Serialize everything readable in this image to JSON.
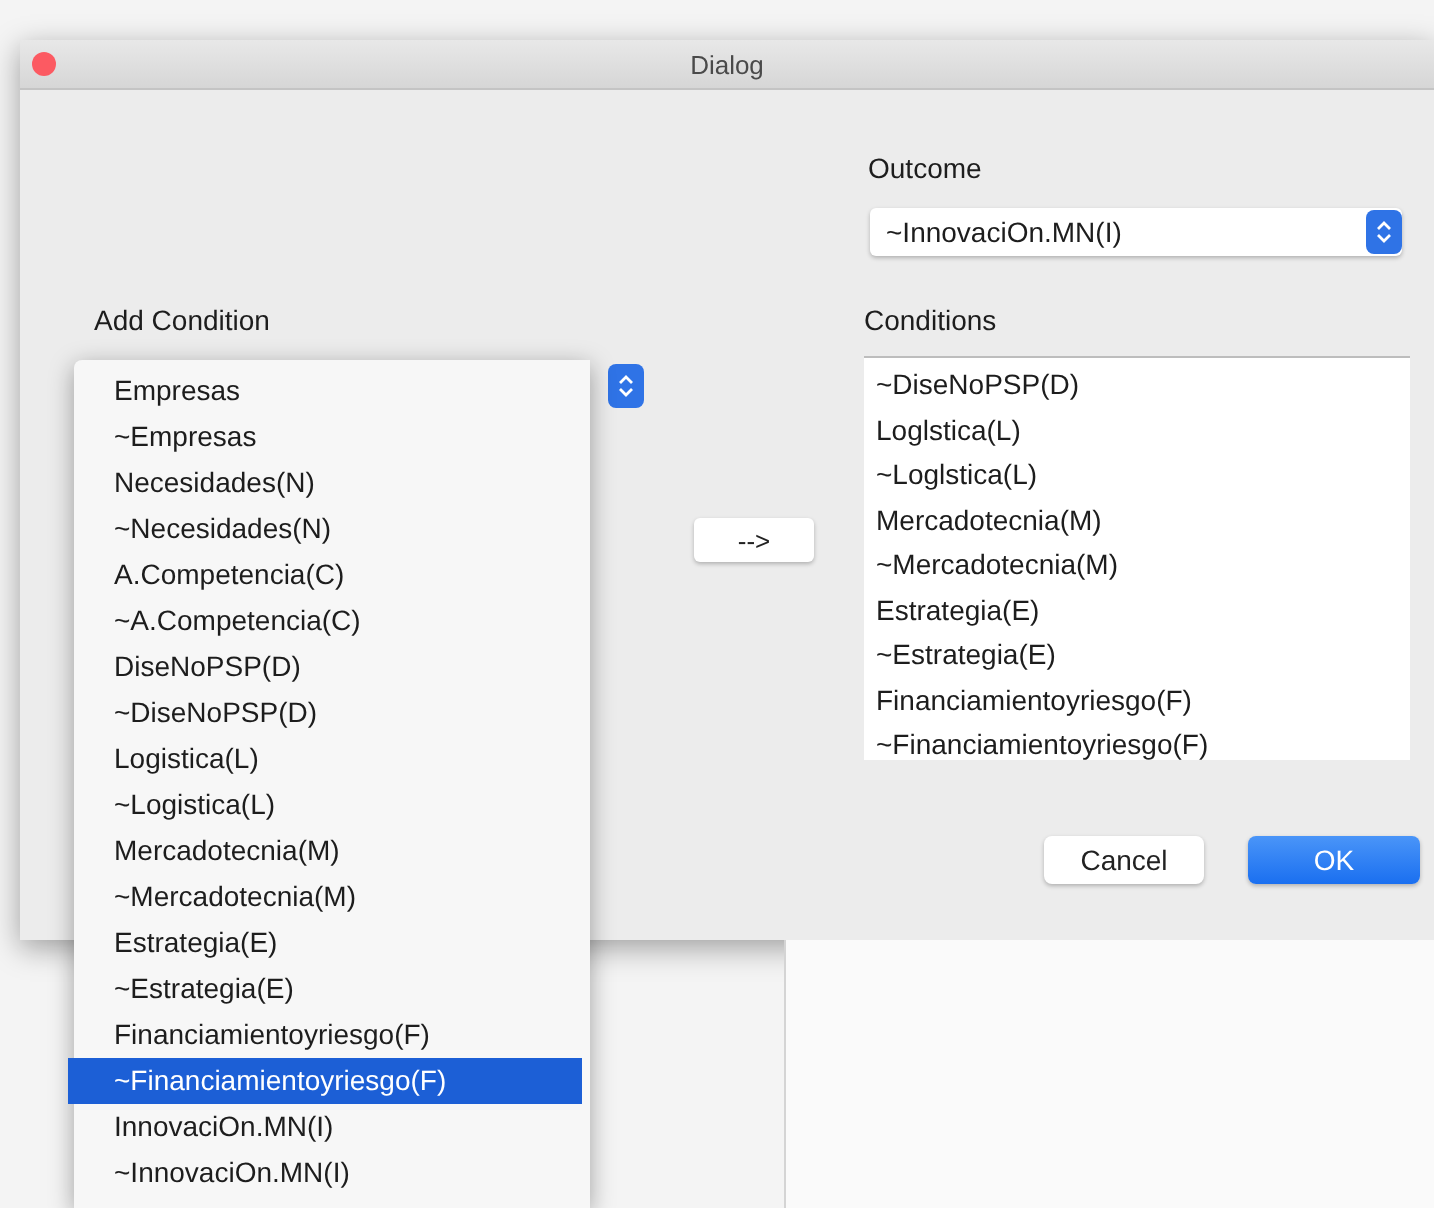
{
  "window": {
    "title": "Dialog"
  },
  "outcome": {
    "label": "Outcome",
    "value": "~InnovaciOn.MN(I)"
  },
  "add_condition": {
    "label": "Add Condition",
    "options": [
      {
        "label": "Empresas",
        "selected": false
      },
      {
        "label": "~Empresas",
        "selected": false
      },
      {
        "label": "Necesidades(N)",
        "selected": false
      },
      {
        "label": "~Necesidades(N)",
        "selected": false
      },
      {
        "label": "A.Competencia(C)",
        "selected": false
      },
      {
        "label": "~A.Competencia(C)",
        "selected": false
      },
      {
        "label": "DiseNoPSP(D)",
        "selected": false
      },
      {
        "label": "~DiseNoPSP(D)",
        "selected": false
      },
      {
        "label": "Logistica(L)",
        "selected": false
      },
      {
        "label": "~Logistica(L)",
        "selected": false
      },
      {
        "label": "Mercadotecnia(M)",
        "selected": false
      },
      {
        "label": "~Mercadotecnia(M)",
        "selected": false
      },
      {
        "label": "Estrategia(E)",
        "selected": false
      },
      {
        "label": "~Estrategia(E)",
        "selected": false
      },
      {
        "label": "Financiamientoyriesgo(F)",
        "selected": false
      },
      {
        "label": "~Financiamientoyriesgo(F)",
        "selected": true
      },
      {
        "label": "InnovaciOn.MN(I)",
        "selected": false
      },
      {
        "label": "~InnovaciOn.MN(I)",
        "selected": false
      }
    ]
  },
  "add_button": {
    "label": "-->"
  },
  "conditions": {
    "label": "Conditions",
    "items": [
      "~DiseNoPSP(D)",
      "Loglstica(L)",
      "~Loglstica(L)",
      "Mercadotecnia(M)",
      "~Mercadotecnia(M)",
      "Estrategia(E)",
      "~Estrategia(E)",
      "Financiamientoyriesgo(F)",
      "~Financiamientoyriesgo(F)"
    ]
  },
  "buttons": [
    {
      "label": "Cancel",
      "kind": "secondary"
    },
    {
      "label": "OK",
      "kind": "primary"
    }
  ]
}
